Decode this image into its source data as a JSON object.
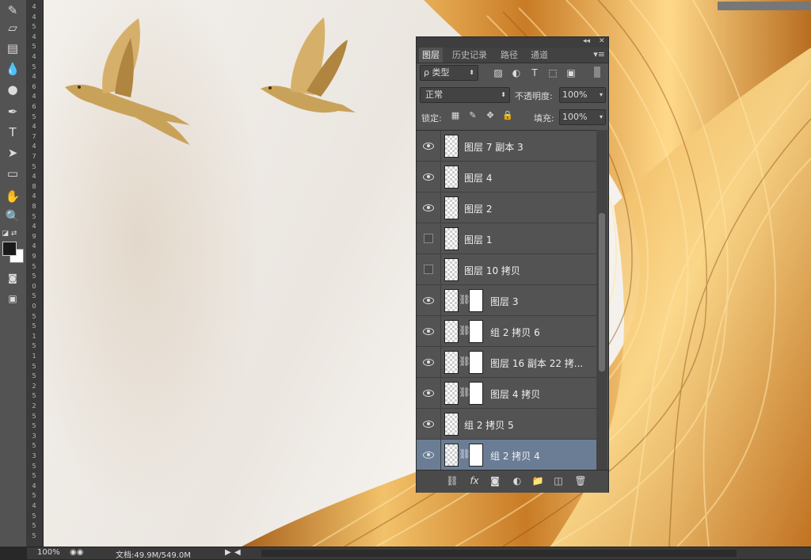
{
  "statusbar": {
    "zoom": "100%",
    "doc": "文档:49.9M/549.0M"
  },
  "ruler": {
    "labels": [
      "4",
      "4",
      "5",
      "4",
      "5",
      "4",
      "5",
      "4",
      "6",
      "4",
      "6",
      "5",
      "4",
      "7",
      "4",
      "7",
      "5",
      "4",
      "8",
      "4",
      "8",
      "5",
      "4",
      "9",
      "4",
      "9",
      "5",
      "5",
      "0",
      "5",
      "0",
      "5",
      "5",
      "1",
      "5",
      "1",
      "5",
      "5",
      "2",
      "5",
      "2",
      "5",
      "5",
      "3",
      "5",
      "3",
      "5",
      "5",
      "4",
      "5",
      "4",
      "5",
      "5",
      "5"
    ]
  },
  "panel": {
    "tabs": [
      "图层",
      "历史记录",
      "路径",
      "通道"
    ],
    "filter_label": "ρ 类型",
    "blend_mode": "正常",
    "opacity_label": "不透明度:",
    "opacity_value": "100%",
    "lock_label": "锁定:",
    "fill_label": "填充:",
    "fill_value": "100%",
    "layers": [
      {
        "name": "图层 7 副本 3",
        "visible": true,
        "mask": false
      },
      {
        "name": "图层 4",
        "visible": true,
        "mask": false
      },
      {
        "name": "图层 2",
        "visible": true,
        "mask": false
      },
      {
        "name": "图层 1",
        "visible": false,
        "mask": false
      },
      {
        "name": "图层 10 拷贝",
        "visible": false,
        "mask": false
      },
      {
        "name": "图层 3",
        "visible": true,
        "mask": true
      },
      {
        "name": "组 2 拷贝 6",
        "visible": true,
        "mask": true
      },
      {
        "name": "图层 16 副本 22 拷...",
        "visible": true,
        "mask": true
      },
      {
        "name": "图层 4 拷贝",
        "visible": true,
        "mask": true
      },
      {
        "name": "组 2 拷贝 5",
        "visible": true,
        "mask": false
      },
      {
        "name": "组 2 拷贝 4",
        "visible": true,
        "mask": true,
        "selected": true
      }
    ]
  },
  "colors": {
    "accent_selected": "#6a7d95",
    "panel_bg": "#535353",
    "gold": "#d99a3a"
  }
}
